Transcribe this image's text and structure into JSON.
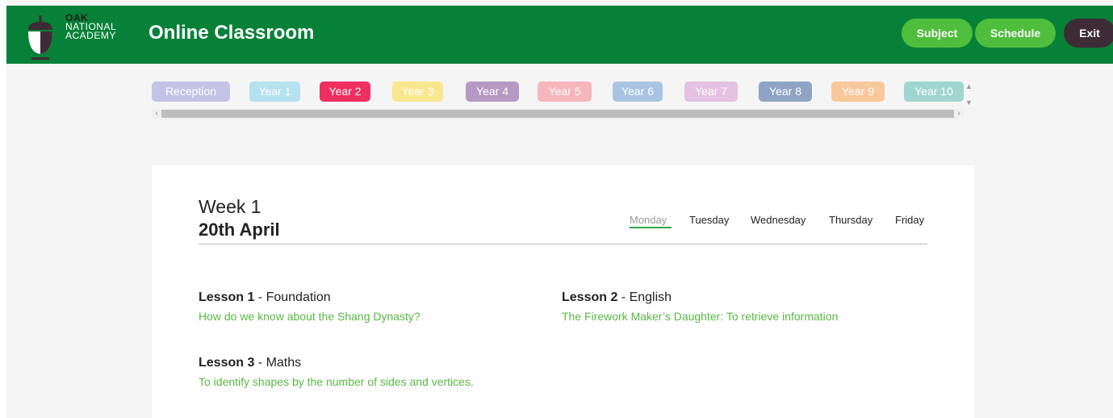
{
  "brand": {
    "line1": "OAK",
    "line2": "NATIONAL",
    "line3": "ACADEMY",
    "logo_icon": "acorn-icon"
  },
  "header": {
    "title": "Online Classroom",
    "subject_label": "Subject",
    "schedule_label": "Schedule",
    "exit_label": "Exit"
  },
  "year_tabs": [
    {
      "label": "Reception",
      "color": "#c4c3e6"
    },
    {
      "label": "Year 1",
      "color": "#b6e1ef"
    },
    {
      "label": "Year 2",
      "color": "#ee2f60",
      "selected": true
    },
    {
      "label": "Year 3",
      "color": "#f9e78f"
    },
    {
      "label": "Year 4",
      "color": "#b59ac4"
    },
    {
      "label": "Year 5",
      "color": "#f5b7bb"
    },
    {
      "label": "Year 6",
      "color": "#a8c4e2"
    },
    {
      "label": "Year 7",
      "color": "#e5c2e1"
    },
    {
      "label": "Year 8",
      "color": "#8fa4c4"
    },
    {
      "label": "Year 9",
      "color": "#f8c89d"
    },
    {
      "label": "Year 10",
      "color": "#9fd6d0"
    }
  ],
  "schedule": {
    "week": "Week 1",
    "date": "20th April",
    "days": [
      "Monday",
      "Tuesday",
      "Wednesday",
      "Thursday",
      "Friday"
    ],
    "active_day": "Monday"
  },
  "lessons": [
    {
      "number": "Lesson 1",
      "subject": " - Foundation",
      "title": "How do we know about the Shang Dynasty?"
    },
    {
      "number": "Lesson 2",
      "subject": " - English",
      "title": "The Firework Maker’s Daughter: To retrieve information"
    },
    {
      "number": "Lesson 3",
      "subject": " - Maths",
      "title": "To identify shapes by the number of sides and vertices."
    }
  ],
  "colors": {
    "header_green": "#078138",
    "button_green": "#4fbe3c",
    "exit_dark": "#3d2b35",
    "link_green": "#59b844"
  }
}
